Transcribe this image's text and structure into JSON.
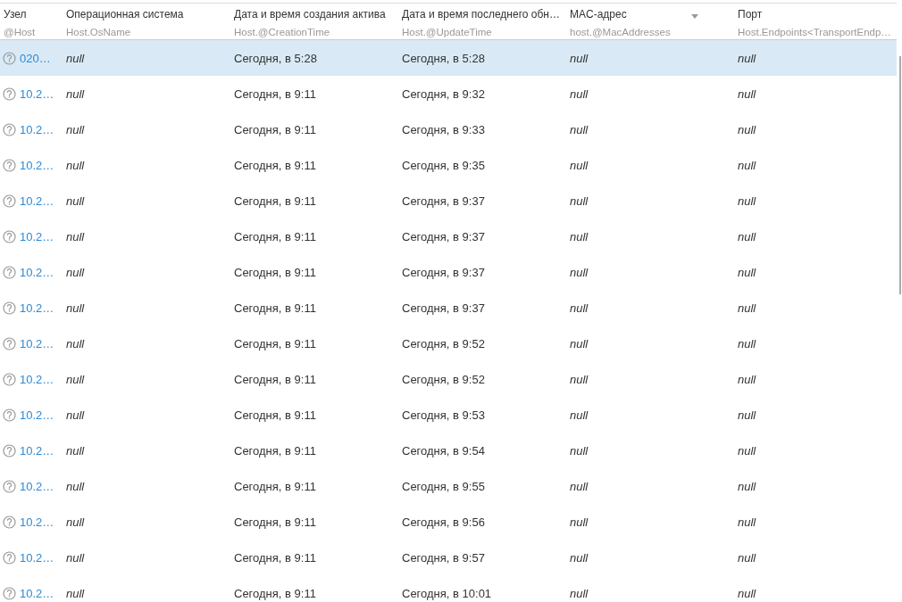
{
  "table": {
    "columns": [
      {
        "title": "Узел",
        "field": "@Host",
        "sorted": false
      },
      {
        "title": "Операционная система",
        "field": "Host.OsName",
        "sorted": false
      },
      {
        "title": "Дата и время создания актива",
        "field": "Host.@CreationTime",
        "sorted": false
      },
      {
        "title": "Дата и время последнего обн…",
        "field": "Host.@UpdateTime",
        "sorted": false
      },
      {
        "title": "MAC-адрес",
        "field": "host.@MacAddresses",
        "sorted": true
      },
      {
        "title": "Порт",
        "field": "Host.Endpoints<TransportEndp…",
        "sorted": false
      }
    ],
    "rows": [
      {
        "selected": true,
        "host": "020…",
        "os": "null",
        "created": "Сегодня, в 5:28",
        "updated": "Сегодня, в 5:28",
        "mac": "null",
        "port": "null"
      },
      {
        "selected": false,
        "host": "10.2…",
        "os": "null",
        "created": "Сегодня, в 9:11",
        "updated": "Сегодня, в 9:32",
        "mac": "null",
        "port": "null"
      },
      {
        "selected": false,
        "host": "10.2…",
        "os": "null",
        "created": "Сегодня, в 9:11",
        "updated": "Сегодня, в 9:33",
        "mac": "null",
        "port": "null"
      },
      {
        "selected": false,
        "host": "10.2…",
        "os": "null",
        "created": "Сегодня, в 9:11",
        "updated": "Сегодня, в 9:35",
        "mac": "null",
        "port": "null"
      },
      {
        "selected": false,
        "host": "10.2…",
        "os": "null",
        "created": "Сегодня, в 9:11",
        "updated": "Сегодня, в 9:37",
        "mac": "null",
        "port": "null"
      },
      {
        "selected": false,
        "host": "10.2…",
        "os": "null",
        "created": "Сегодня, в 9:11",
        "updated": "Сегодня, в 9:37",
        "mac": "null",
        "port": "null"
      },
      {
        "selected": false,
        "host": "10.2…",
        "os": "null",
        "created": "Сегодня, в 9:11",
        "updated": "Сегодня, в 9:37",
        "mac": "null",
        "port": "null"
      },
      {
        "selected": false,
        "host": "10.2…",
        "os": "null",
        "created": "Сегодня, в 9:11",
        "updated": "Сегодня, в 9:37",
        "mac": "null",
        "port": "null"
      },
      {
        "selected": false,
        "host": "10.2…",
        "os": "null",
        "created": "Сегодня, в 9:11",
        "updated": "Сегодня, в 9:52",
        "mac": "null",
        "port": "null"
      },
      {
        "selected": false,
        "host": "10.2…",
        "os": "null",
        "created": "Сегодня, в 9:11",
        "updated": "Сегодня, в 9:52",
        "mac": "null",
        "port": "null"
      },
      {
        "selected": false,
        "host": "10.2…",
        "os": "null",
        "created": "Сегодня, в 9:11",
        "updated": "Сегодня, в 9:53",
        "mac": "null",
        "port": "null"
      },
      {
        "selected": false,
        "host": "10.2…",
        "os": "null",
        "created": "Сегодня, в 9:11",
        "updated": "Сегодня, в 9:54",
        "mac": "null",
        "port": "null"
      },
      {
        "selected": false,
        "host": "10.2…",
        "os": "null",
        "created": "Сегодня, в 9:11",
        "updated": "Сегодня, в 9:55",
        "mac": "null",
        "port": "null"
      },
      {
        "selected": false,
        "host": "10.2…",
        "os": "null",
        "created": "Сегодня, в 9:11",
        "updated": "Сегодня, в 9:56",
        "mac": "null",
        "port": "null"
      },
      {
        "selected": false,
        "host": "10.2…",
        "os": "null",
        "created": "Сегодня, в 9:11",
        "updated": "Сегодня, в 9:57",
        "mac": "null",
        "port": "null"
      },
      {
        "selected": false,
        "host": "10.2…",
        "os": "null",
        "created": "Сегодня, в 9:11",
        "updated": "Сегодня, в 10:01",
        "mac": "null",
        "port": "null"
      }
    ]
  }
}
